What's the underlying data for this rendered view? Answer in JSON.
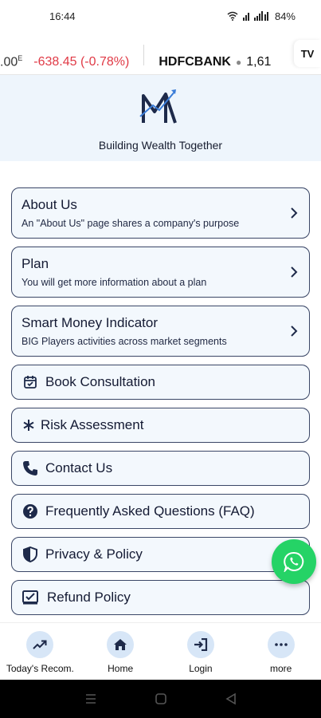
{
  "status_bar": {
    "time": "16:44",
    "battery": "84%"
  },
  "ticker": {
    "prev_price_fragment": ".00",
    "prev_marker": "E",
    "change": "-638.45 (-0.78%)",
    "next_symbol": "HDFCBANK",
    "next_value": "1,61",
    "provider_logo": "TV"
  },
  "header": {
    "tagline": "Building Wealth Together",
    "logo_letter": "M"
  },
  "menu": {
    "items": [
      {
        "title": "About Us",
        "subtitle": "An \"About Us\" page shares a company's purpose"
      },
      {
        "title": "Plan",
        "subtitle": "You will get more information about a plan"
      },
      {
        "title": "Smart Money Indicator",
        "subtitle": "BIG Players activities across market segments"
      },
      {
        "title": "Book Consultation",
        "icon": "calendar-check-icon"
      },
      {
        "title": "Risk Assessment",
        "icon": "asterisk-icon"
      },
      {
        "title": "Contact Us",
        "icon": "phone-icon"
      },
      {
        "title": "Frequently Asked Questions (FAQ)",
        "icon": "help-circle-icon"
      },
      {
        "title": "Privacy & Policy",
        "icon": "shield-icon"
      },
      {
        "title": "Refund Policy",
        "icon": "refund-icon"
      }
    ]
  },
  "bottom_nav": {
    "items": [
      {
        "label": "Today's Recom.",
        "icon": "trending-up-icon"
      },
      {
        "label": "Home",
        "icon": "home-icon"
      },
      {
        "label": "Login",
        "icon": "login-icon"
      },
      {
        "label": "more",
        "icon": "more-dots-icon"
      }
    ]
  },
  "colors": {
    "accent": "#1e2a4a",
    "whatsapp": "#25d366",
    "ticker_down": "#e03a46",
    "header_bg": "#eef5fc"
  }
}
